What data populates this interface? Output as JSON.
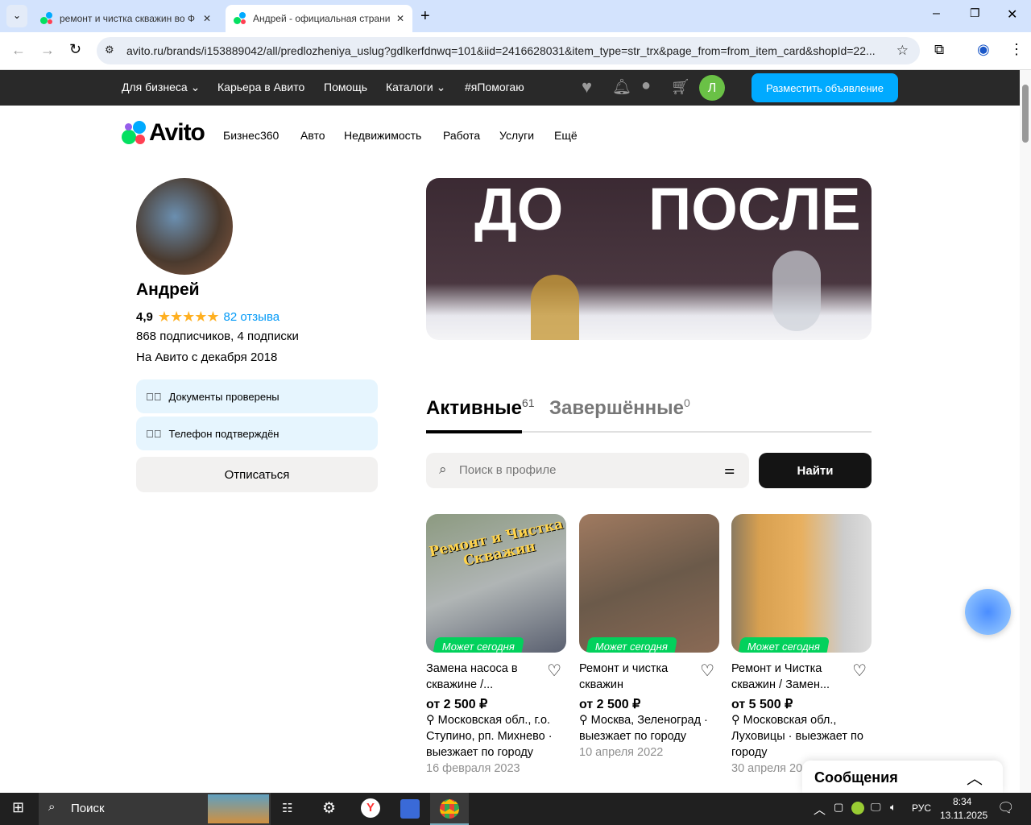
{
  "browser": {
    "tabs": [
      {
        "title": "ремонт и чистка скважин во Ф"
      },
      {
        "title": "Андрей - официальная страни"
      }
    ],
    "url": "avito.ru/brands/i153889042/all/predlozheniya_uslug?gdlkerfdnwq=101&iid=2416628031&item_type=str_trx&page_from=from_item_card&shopId=22..."
  },
  "topnav": {
    "items": [
      "Для бизнеса ⌄",
      "Карьера в Авито",
      "Помощь",
      "Каталоги ⌄",
      "#яПомогаю"
    ],
    "avatar_letter": "Л",
    "post_button": "Разместить объявление"
  },
  "header": {
    "logo": "Avito",
    "categories": [
      "Бизнес360",
      "Авто",
      "Недвижимость",
      "Работа",
      "Услуги",
      "Ещё"
    ]
  },
  "profile": {
    "name": "Андрей",
    "rating": "4,9",
    "rating_stars": 4.9,
    "reviews": "82 отзыва",
    "subscribers": "868 подписчиков, 4 подписки",
    "since": "На Авито с декабря 2018",
    "checks": [
      "Документы проверены",
      "Телефон подтверждён"
    ],
    "unsubscribe": "Отписаться"
  },
  "banner": {
    "before": "ДО",
    "after": "ПОСЛЕ"
  },
  "tabs": {
    "active": {
      "label": "Активные",
      "count": "61"
    },
    "finished": {
      "label": "Завершённые",
      "count": "0"
    }
  },
  "search": {
    "placeholder": "Поиск в профиле",
    "button": "Найти"
  },
  "listings": [
    {
      "badge": "Может сегодня",
      "image_text": "Ремонт и Чистка Скважин",
      "title": "Замена насоса в скважине /...",
      "price": "от 2 500 ₽",
      "location": "Московская обл., г.о. Ступино, рп. Михнево · выезжает по городу",
      "date": "16 февраля 2023"
    },
    {
      "badge": "Может сегодня",
      "title": "Ремонт и чистка скважин",
      "price": "от 2 500 ₽",
      "location": "Москва, Зеленоград · выезжает по городу",
      "date": "10 апреля 2022"
    },
    {
      "badge": "Может сегодня",
      "title": "Ремонт и Чистка скважин / Замен...",
      "price": "от 5 500 ₽",
      "location": "Московская обл., Луховицы · выезжает по городу",
      "date": "30 апреля 20"
    }
  ],
  "messages": {
    "label": "Сообщения"
  },
  "taskbar": {
    "search": "Поиск",
    "lang": "РУС",
    "time": "8:34",
    "date": "13.11.2025"
  }
}
